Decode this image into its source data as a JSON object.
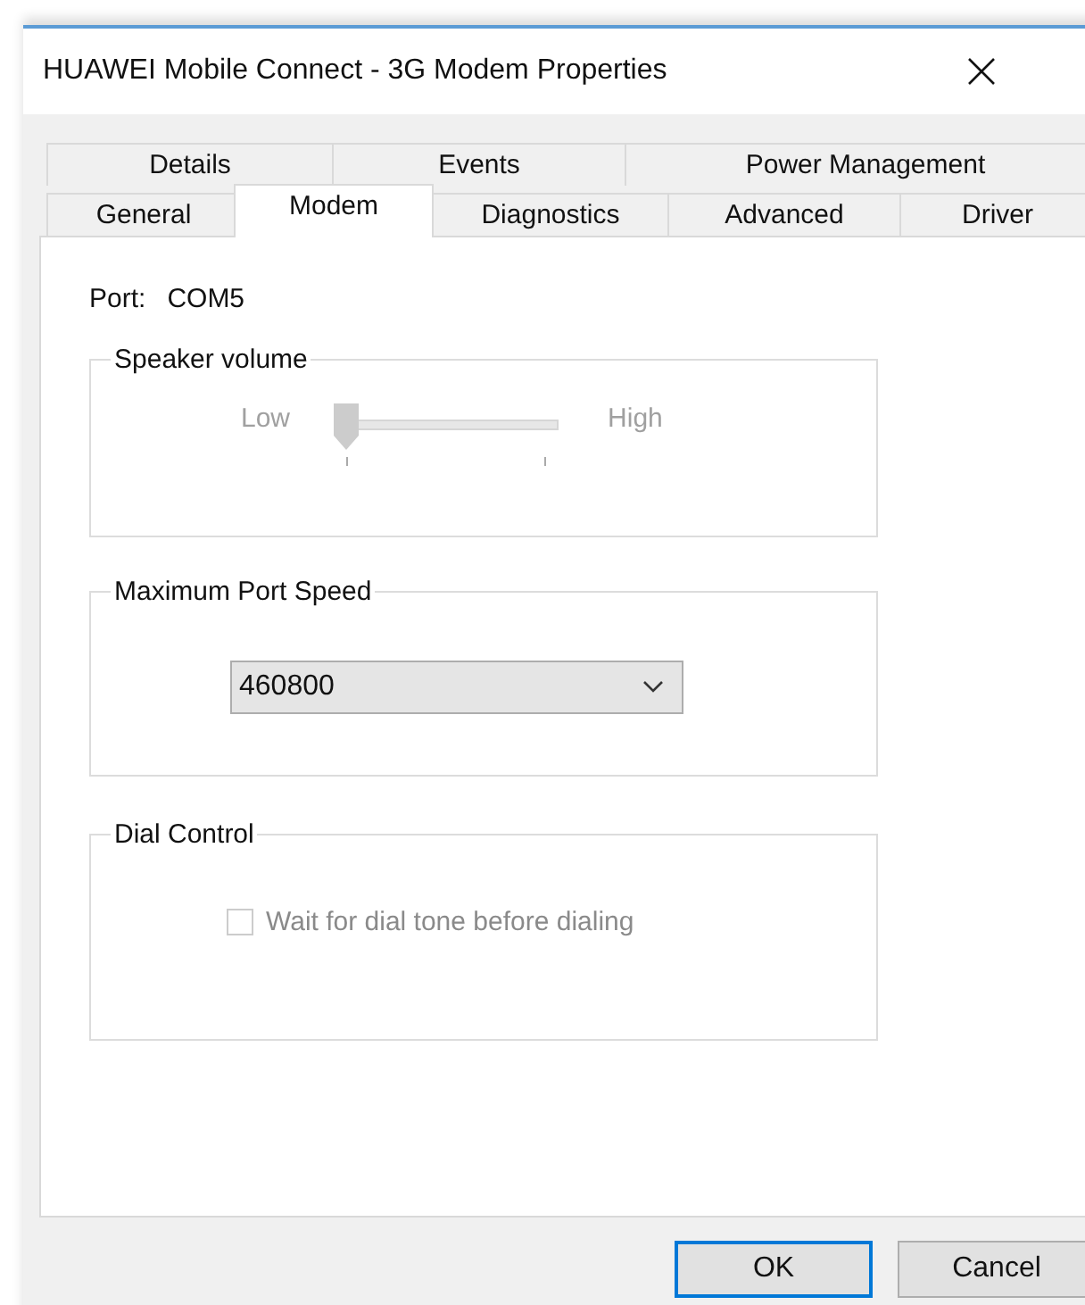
{
  "window": {
    "title": "HUAWEI Mobile Connect - 3G Modem Properties"
  },
  "tab_rows": [
    {
      "tabs": [
        {
          "label": "Details",
          "selected": false
        },
        {
          "label": "Events",
          "selected": false
        },
        {
          "label": "Power Management",
          "selected": false
        }
      ]
    },
    {
      "tabs": [
        {
          "label": "General",
          "selected": false
        },
        {
          "label": "Modem",
          "selected": true
        },
        {
          "label": "Diagnostics",
          "selected": false
        },
        {
          "label": "Advanced",
          "selected": false
        },
        {
          "label": "Driver",
          "selected": false
        }
      ]
    }
  ],
  "port": {
    "label": "Port:",
    "value": "COM5"
  },
  "speaker_volume": {
    "title": "Speaker volume",
    "low_label": "Low",
    "high_label": "High",
    "disabled": true,
    "level": 0
  },
  "max_port_speed": {
    "title": "Maximum Port Speed",
    "value": "460800"
  },
  "dial_control": {
    "title": "Dial Control",
    "checkbox": {
      "label": "Wait for dial tone before dialing",
      "checked": false,
      "disabled": true
    }
  },
  "buttons": [
    {
      "label": "OK",
      "default": true
    },
    {
      "label": "Cancel",
      "default": false
    }
  ]
}
